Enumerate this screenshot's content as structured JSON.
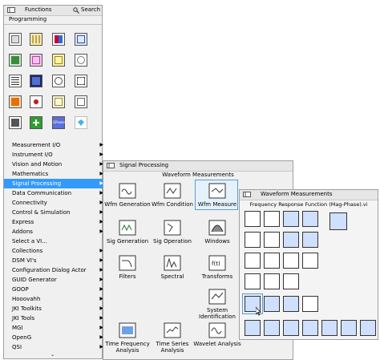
{
  "functions_panel": {
    "title": "Functions",
    "search_label": "Search",
    "programming_label": "Programming",
    "menu_items": [
      "Measurement I/O",
      "Instrument I/O",
      "Vision and Motion",
      "Mathematics",
      "Signal Processing",
      "Data Communication",
      "Connectivity",
      "Control & Simulation",
      "Express",
      "Addons",
      "Select a VI...",
      "Collections",
      "DSM VI's",
      "Configuration Dialog Actor",
      "GUID Generator",
      "GOOP",
      "Hooovahh",
      "JKI Toolkits",
      "JKI Tools",
      "MGI",
      "OpenG",
      "QSI"
    ],
    "selected_item": "Signal Processing",
    "gpower_label": "GPower"
  },
  "signal_panel": {
    "title": "Signal Processing",
    "section": "Waveform Measurements",
    "items": [
      "Wfm Generation",
      "Wfm Condition",
      "Wfm Measure",
      "Sig Generation",
      "Sig Operation",
      "Windows",
      "Filters",
      "Spectral",
      "Transforms",
      "System Identification",
      "Time Frequency Analysis",
      "Time Series Analysis",
      "Wavelet Analysis"
    ]
  },
  "waveform_panel": {
    "title": "Waveform Measurements",
    "hover_label": "Frequency Response Function (Mag-Phase).vi"
  }
}
